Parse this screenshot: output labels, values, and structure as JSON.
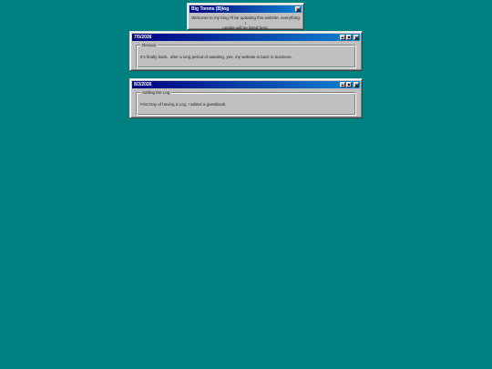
{
  "welcome": {
    "title": "Big Tonms (B)log",
    "message_line1": "Welcome to my blog I'll be updating this website, everything I",
    "message_line2": "update will be listed here."
  },
  "posts": [
    {
      "date": "7/5/2026",
      "heading": "Revival",
      "body": "It's finally back.. after a long period of awaiting, yes, my website is back in business."
    },
    {
      "date": "8/3/2026",
      "heading": "Adding the Log",
      "body": "First Day of having a Log, I added a guestbook."
    }
  ],
  "colors": {
    "desktop": "#008080",
    "titlebar_start": "#000080",
    "titlebar_end": "#1084d0",
    "window_face": "#c0c0c0"
  },
  "icons": {
    "minimize": "minimize-icon",
    "maximize": "maximize-icon",
    "close": "close-icon"
  }
}
